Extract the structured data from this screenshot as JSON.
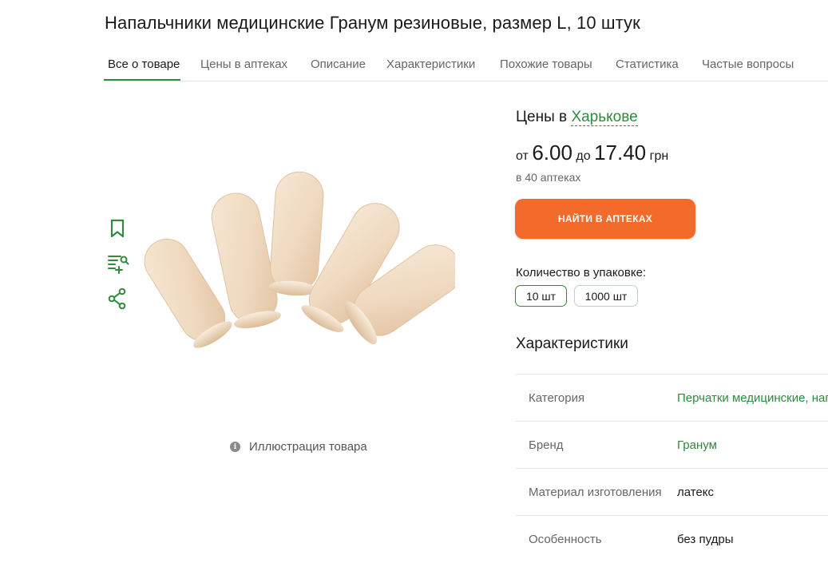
{
  "product": {
    "title": "Напальчники медицинские Гранум резиновые, размер L, 10 штук",
    "illustration_note": "Иллюстрация товара"
  },
  "tabs": [
    {
      "label": "Все о товаре",
      "active": true
    },
    {
      "label": "Цены в аптеках"
    },
    {
      "label": "Описание"
    },
    {
      "label": "Характеристики"
    },
    {
      "label": "Похожие товары"
    },
    {
      "label": "Статистика"
    },
    {
      "label": "Частые вопросы"
    }
  ],
  "side_icons": [
    "bookmark-icon",
    "add-to-list-icon",
    "share-icon"
  ],
  "prices": {
    "label": "Цены в",
    "city": "Харькове",
    "from_word": "от",
    "min": "6.00",
    "to_word": "до",
    "max": "17.40",
    "currency": "грн",
    "pharmacy_count": "в 40 аптеках"
  },
  "find_button": "НАЙТИ В АПТЕКАХ",
  "quantity": {
    "label": "Количество в упаковке:",
    "options": [
      "10 шт",
      "1000 шт"
    ],
    "selected": "10 шт"
  },
  "characteristics": {
    "title": "Характеристики",
    "rows": [
      {
        "key": "Категория",
        "value": "Перчатки медицинские, нап"
      },
      {
        "key": "Бренд",
        "value": "Гранум"
      },
      {
        "key": "Материал изготовления",
        "value": "латекс"
      },
      {
        "key": "Особенность",
        "value": "без пудры"
      }
    ]
  },
  "colors": {
    "accent_green": "#2e8b3b",
    "button_orange": "#f26b2b"
  }
}
